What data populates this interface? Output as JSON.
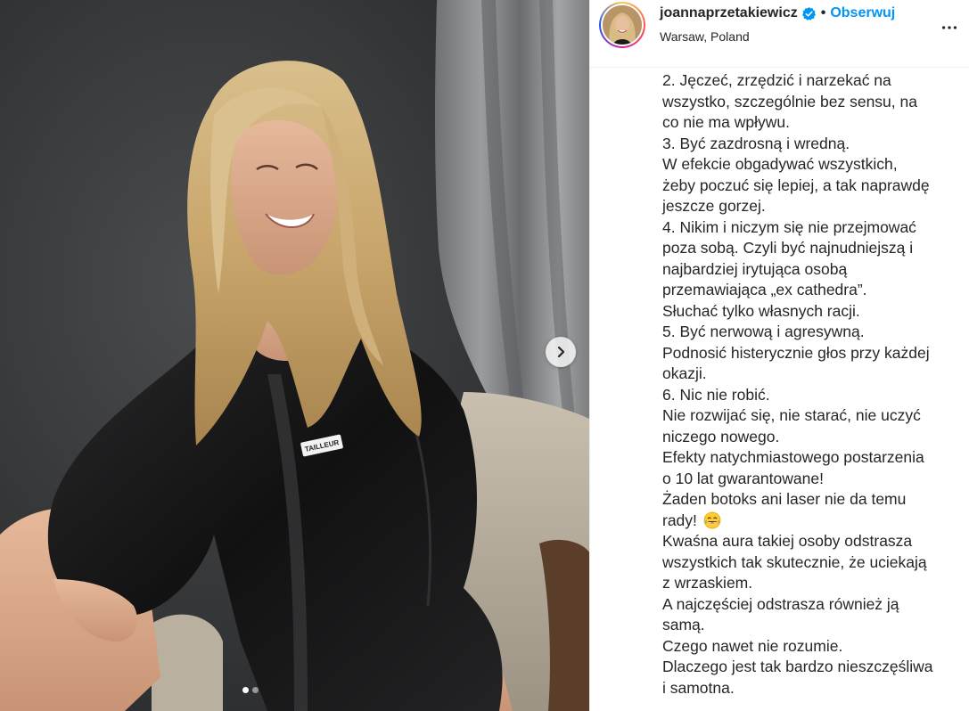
{
  "post": {
    "username": "joannaprzetakiewicz",
    "separator": "•",
    "follow_label": "Obserwuj",
    "location": "Warsaw, Poland"
  },
  "icons": {
    "verified": "verified-badge-icon",
    "more": "more-options-icon",
    "next": "chevron-right-icon",
    "emoji": "laughing-tears-emoji-icon"
  },
  "colors": {
    "accent": "#0095f6",
    "text": "#262626"
  },
  "carousel": {
    "total_slides": 2,
    "active_slide": 1
  },
  "photo": {
    "label_text": "TAILLEUR"
  },
  "caption_lines": [
    "2. Jęczeć, zrzędzić i narzekać na",
    "wszystko, szczególnie bez sensu, na",
    "co nie ma wpływu.",
    "3. Być zazdrosną i wredną.",
    "W efekcie obgadywać wszystkich,",
    "żeby poczuć się lepiej, a tak naprawdę",
    "jeszcze gorzej.",
    "4. Nikim i niczym się nie przejmować",
    "poza sobą. Czyli być najnudniejszą i",
    "najbardziej irytująca osobą",
    "przemawiająca „ex cathedra”.",
    "Słuchać tylko własnych racji.",
    "5. Być nerwową i agresywną.",
    "Podnosić histerycznie głos przy każdej",
    "okazji.",
    "6. Nic nie robić.",
    "Nie rozwijać się, nie starać, nie uczyć",
    "niczego nowego.",
    "Efekty natychmiastowego postarzenia",
    "o 10 lat gwarantowane!",
    "Żaden botoks ani laser nie da temu",
    "rady!",
    "Kwaśna aura takiej osoby odstrasza",
    "wszystkich tak skutecznie, że uciekają",
    "z wrzaskiem.",
    "A najczęściej odstrasza również ją",
    "samą.",
    "Czego nawet nie rozumie.",
    "Dlaczego jest tak bardzo nieszczęśliwa",
    "i samotna."
  ]
}
